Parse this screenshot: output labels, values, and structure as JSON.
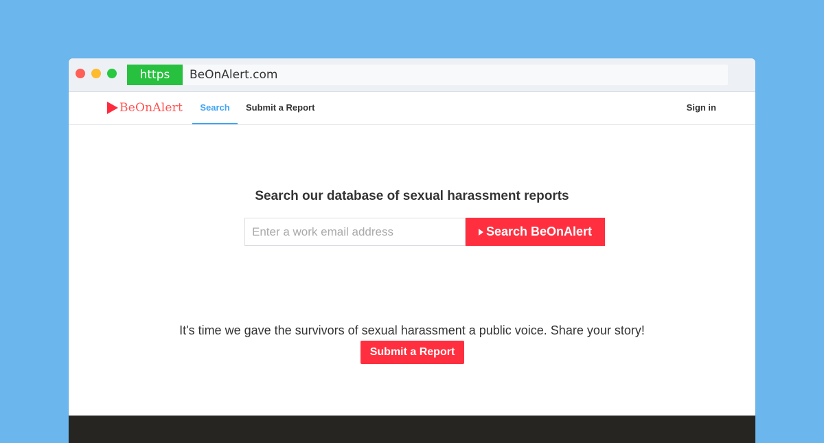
{
  "browser": {
    "protocol_label": "https",
    "url": "BeOnAlert.com",
    "colors": {
      "background": "#6cb6ee",
      "https_badge": "#27c13f"
    }
  },
  "brand": {
    "name": "BeOnAlert",
    "accent": "#ff2f3f",
    "logo_icon": "play-icon"
  },
  "nav": {
    "search_label": "Search",
    "submit_report_label": "Submit a Report",
    "sign_in_label": "Sign in"
  },
  "hero": {
    "title": "Search our database of sexual harassment reports",
    "search_placeholder": "Enter a work email address",
    "search_button_label": "Search BeOnAlert"
  },
  "cta": {
    "tagline": "It's time we gave the survivors of sexual harassment a public voice. Share your story!",
    "button_label": "Submit a Report"
  }
}
